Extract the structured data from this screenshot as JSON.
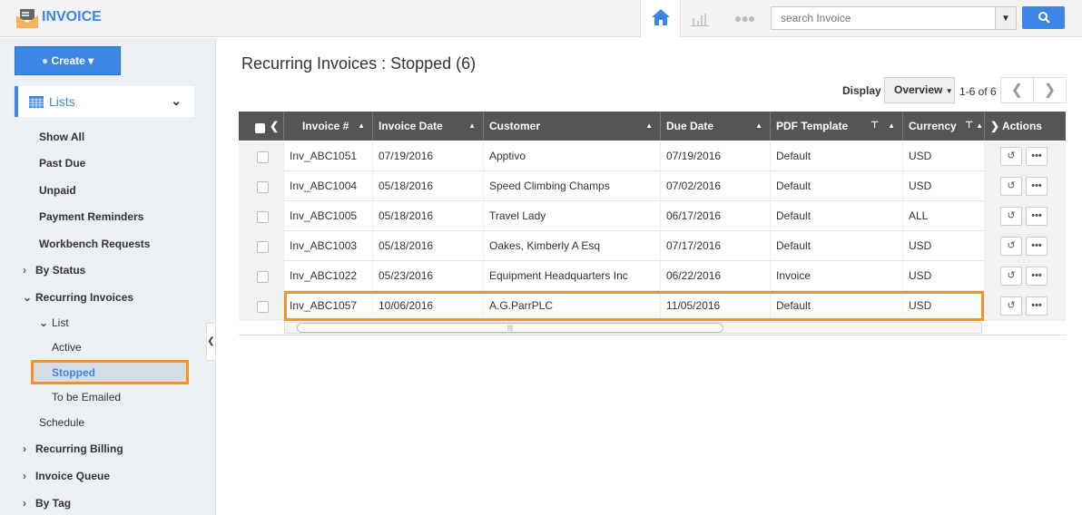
{
  "app": {
    "title": "INVOICE"
  },
  "header": {
    "search_placeholder": "search Invoice",
    "icons": [
      "home-icon",
      "bar-chart-icon",
      "more-icon",
      "search-icon"
    ]
  },
  "sidebar": {
    "create_label": "Create",
    "lists_label": "Lists",
    "items": [
      {
        "label": "Show All"
      },
      {
        "label": "Past Due"
      },
      {
        "label": "Unpaid"
      },
      {
        "label": "Payment Reminders"
      },
      {
        "label": "Workbench Requests"
      },
      {
        "label": "By Status"
      },
      {
        "label": "Recurring Invoices"
      },
      {
        "label": "List"
      },
      {
        "label": "Active"
      },
      {
        "label": "Stopped"
      },
      {
        "label": "To be Emailed"
      },
      {
        "label": "Schedule"
      },
      {
        "label": "Recurring Billing"
      },
      {
        "label": "Invoice Queue"
      },
      {
        "label": "By Tag"
      }
    ]
  },
  "main": {
    "title": "Recurring Invoices : Stopped (6)",
    "display_label": "Display",
    "display_value": "Overview",
    "pagination": "1-6 of 6",
    "columns": [
      "Invoice #",
      "Invoice Date",
      "Customer",
      "Due Date",
      "PDF Template",
      "Currency",
      "Actions"
    ],
    "rows": [
      [
        "Inv_ABC1051",
        "07/19/2016",
        "Apptivo",
        "07/19/2016",
        "Default",
        "USD"
      ],
      [
        "Inv_ABC1004",
        "05/18/2016",
        "Speed Climbing Champs",
        "07/02/2016",
        "Default",
        "USD"
      ],
      [
        "Inv_ABC1005",
        "05/18/2016",
        "Travel Lady",
        "06/17/2016",
        "Default",
        "ALL"
      ],
      [
        "Inv_ABC1003",
        "05/18/2016",
        "Oakes, Kimberly A Esq",
        "07/17/2016",
        "Default",
        "USD"
      ],
      [
        "Inv_ABC1022",
        "05/23/2016",
        "Equipment Headquarters Inc",
        "06/22/2016",
        "Invoice",
        "USD"
      ],
      [
        "Inv_ABC1057",
        "10/06/2016",
        "A.G.ParrPLC",
        "11/05/2016",
        "Default",
        "USD"
      ]
    ],
    "highlighted_row": 5,
    "highlight_color": "#f7931e",
    "accent_color": "#3d86e6"
  }
}
